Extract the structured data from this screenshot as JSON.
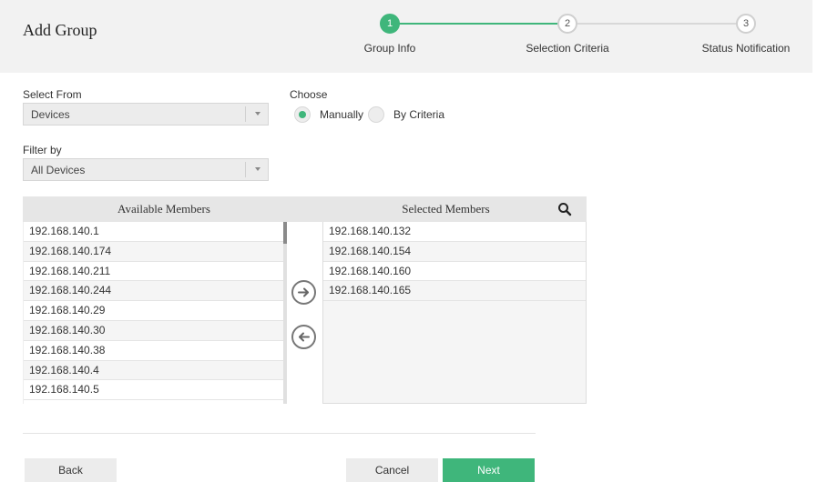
{
  "page": {
    "title": "Add Group"
  },
  "wizard": {
    "steps": [
      {
        "number": "1",
        "label": "Group Info",
        "state": "active"
      },
      {
        "number": "2",
        "label": "Selection Criteria",
        "state": "inactive"
      },
      {
        "number": "3",
        "label": "Status Notification",
        "state": "inactive"
      }
    ],
    "accent_color": "#3fb67b"
  },
  "form": {
    "select_from": {
      "label": "Select From",
      "value": "Devices"
    },
    "filter_by": {
      "label": "Filter by",
      "value": "All Devices"
    },
    "choose": {
      "label": "Choose",
      "options": [
        {
          "label": "Manually",
          "selected": true
        },
        {
          "label": "By Criteria",
          "selected": false
        }
      ]
    }
  },
  "members": {
    "available": {
      "title": "Available Members",
      "items": [
        "192.168.140.1",
        "192.168.140.174",
        "192.168.140.211",
        "192.168.140.244",
        "192.168.140.29",
        "192.168.140.30",
        "192.168.140.38",
        "192.168.140.4",
        "192.168.140.5"
      ]
    },
    "selected": {
      "title": "Selected Members",
      "items": [
        "192.168.140.132",
        "192.168.140.154",
        "192.168.140.160",
        "192.168.140.165"
      ]
    },
    "icons": {
      "add": "arrow-right-icon",
      "remove": "arrow-left-icon",
      "search": "search-icon"
    }
  },
  "buttons": {
    "back": "Back",
    "cancel": "Cancel",
    "next": "Next"
  }
}
